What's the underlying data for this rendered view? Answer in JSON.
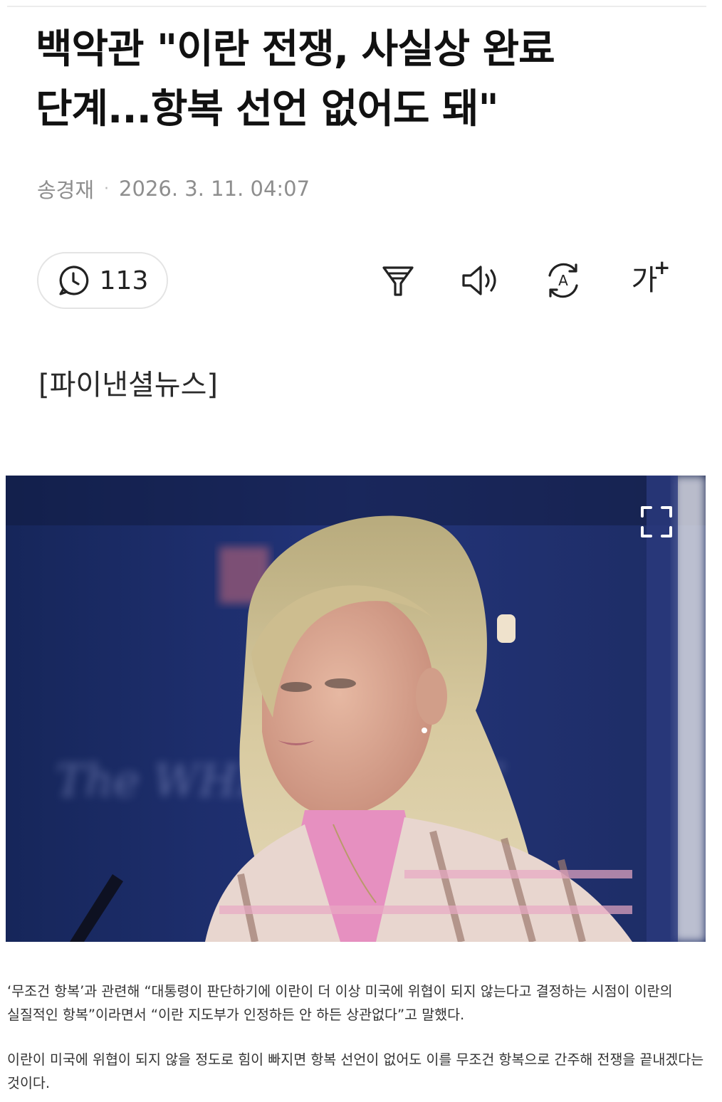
{
  "article": {
    "headline": "백악관 \"이란 전쟁, 사실상 완료 단계...항복 선언 없어도 돼\"",
    "author": "송경재",
    "separator": "·",
    "datetime": "2026. 3. 11. 04:07",
    "source_tag": "[파이낸셜뉴스]",
    "paragraphs": [
      "‘무조건 항복’과 관련해 “대통령이 판단하기에 이란이 더 이상 미국에 위협이 되지 않는다고 결정하는 시점이 이란의 실질적인 항복”이라면서 “이란 지도부가 인정하든 안 하든 상관없다”고 말했다.",
      "이란이 미국에 위협이 되지 않을 정도로 힘이 빠지면 항복 선언이 없어도 이를 무조건 항복으로 간주해 전쟁을 끝내겠다는 것이다."
    ]
  },
  "toolbar": {
    "comment_count": "113",
    "comment_icon": "comment-clock-icon",
    "summary_icon": "summary-funnel-icon",
    "listen_icon": "speaker-icon",
    "translate_icon": "translate-icon",
    "font_size_glyph": "가",
    "font_size_plus": "+"
  },
  "photo": {
    "description_icon": "expand-icon",
    "backdrop_text": "The WHITE HOUSE"
  },
  "colors": {
    "headline": "#111111",
    "meta": "#8e8e8e",
    "body": "#333333",
    "pill_border": "#e4e4e4",
    "photo_backdrop": "#1c2d66"
  }
}
